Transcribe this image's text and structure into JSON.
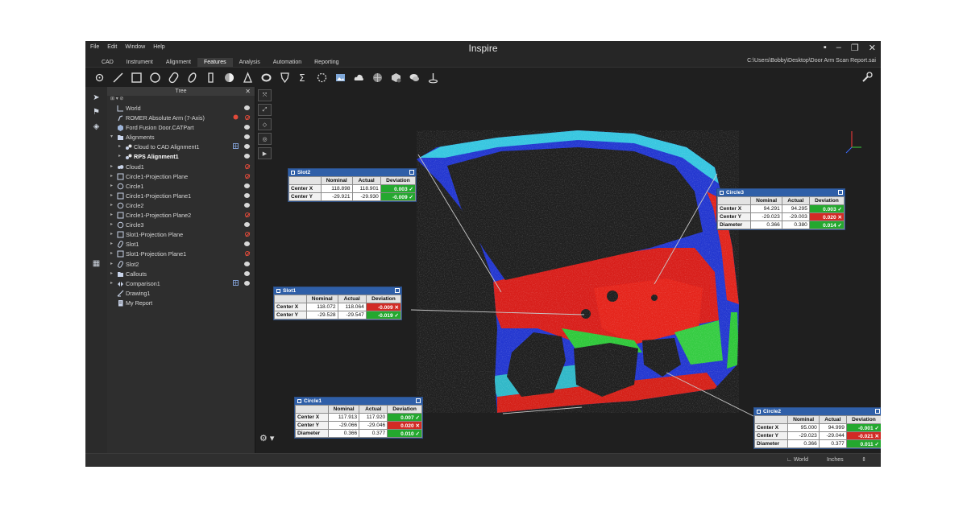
{
  "app": {
    "title": "Inspire",
    "menu": [
      "File",
      "Edit",
      "Window",
      "Help"
    ],
    "tabs": [
      "CAD",
      "Instrument",
      "Alignment",
      "Features",
      "Analysis",
      "Automation",
      "Reporting"
    ],
    "active_tab": "Features",
    "file_path": "C:\\Users\\Bobby\\Desktop\\Door Arm Scan Report.sai"
  },
  "toolbar": {
    "icons": [
      "point-icon",
      "line-icon",
      "plane-icon",
      "circle-icon",
      "slot-icon",
      "ellipse-icon",
      "rectangle-slot-icon",
      "sphere-icon",
      "cone-icon",
      "cylinder-icon",
      "surface-icon",
      "sum-icon",
      "auto-feature-icon",
      "image-icon",
      "cloud-icon",
      "mesh-icon",
      "inspect-icon",
      "comment-icon",
      "probe-icon"
    ]
  },
  "tree": {
    "title": "Tree",
    "items": [
      {
        "label": "World",
        "indent": 0,
        "expand": "",
        "icon": "axis",
        "state": "eye"
      },
      {
        "label": "ROMER Absolute Arm (7-Axis)",
        "indent": 0,
        "expand": "",
        "icon": "arm",
        "state": "hide",
        "mark": "red"
      },
      {
        "label": "Ford Fusion Door.CATPart",
        "indent": 0,
        "expand": "",
        "icon": "part",
        "state": "eye"
      },
      {
        "label": "Alignments",
        "indent": 0,
        "expand": "▾",
        "icon": "folder",
        "state": "eye"
      },
      {
        "label": "Cloud to CAD Alignment1",
        "indent": 1,
        "expand": "▸",
        "icon": "align",
        "state": "eye",
        "mark": "grid"
      },
      {
        "label": "RPS Alignment1",
        "indent": 1,
        "expand": "▸",
        "icon": "align",
        "state": "eye",
        "bold": true
      },
      {
        "label": "Cloud1",
        "indent": 0,
        "expand": "▸",
        "icon": "cloud",
        "state": "hide"
      },
      {
        "label": "Circle1-Projection Plane",
        "indent": 0,
        "expand": "▸",
        "icon": "plane",
        "state": "hide"
      },
      {
        "label": "Circle1",
        "indent": 0,
        "expand": "▸",
        "icon": "circle",
        "state": "eye"
      },
      {
        "label": "Circle1-Projection Plane1",
        "indent": 0,
        "expand": "▸",
        "icon": "plane",
        "state": "eye"
      },
      {
        "label": "Circle2",
        "indent": 0,
        "expand": "▸",
        "icon": "circle",
        "state": "eye"
      },
      {
        "label": "Circle1-Projection Plane2",
        "indent": 0,
        "expand": "▸",
        "icon": "plane",
        "state": "hide"
      },
      {
        "label": "Circle3",
        "indent": 0,
        "expand": "▸",
        "icon": "circle",
        "state": "eye"
      },
      {
        "label": "Slot1-Projection Plane",
        "indent": 0,
        "expand": "▸",
        "icon": "plane",
        "state": "hide"
      },
      {
        "label": "Slot1",
        "indent": 0,
        "expand": "▸",
        "icon": "slot",
        "state": "eye"
      },
      {
        "label": "Slot1-Projection Plane1",
        "indent": 0,
        "expand": "▸",
        "icon": "plane",
        "state": "hide"
      },
      {
        "label": "Slot2",
        "indent": 0,
        "expand": "▸",
        "icon": "slot",
        "state": "eye"
      },
      {
        "label": "Callouts",
        "indent": 0,
        "expand": "▸",
        "icon": "folder",
        "state": "eye"
      },
      {
        "label": "Comparison1",
        "indent": 0,
        "expand": "▸",
        "icon": "compare",
        "state": "eye",
        "mark": "grid"
      },
      {
        "label": "Drawing1",
        "indent": 0,
        "expand": "",
        "icon": "drawing",
        "state": ""
      },
      {
        "label": "My Report",
        "indent": 0,
        "expand": "",
        "icon": "report",
        "state": ""
      }
    ]
  },
  "callout_headers": [
    "",
    "Nominal",
    "Actual",
    "Deviation"
  ],
  "callouts": [
    {
      "title": "Slot2",
      "rows": [
        {
          "label": "Center X",
          "nominal": "118.898",
          "actual": "118.901",
          "deviation": "0.003",
          "status": "pass"
        },
        {
          "label": "Center Y",
          "nominal": "-29.921",
          "actual": "-29.930",
          "deviation": "-0.009",
          "status": "pass"
        }
      ]
    },
    {
      "title": "Circle3",
      "rows": [
        {
          "label": "Center X",
          "nominal": "94.291",
          "actual": "94.295",
          "deviation": "0.003",
          "status": "pass"
        },
        {
          "label": "Center Y",
          "nominal": "-29.023",
          "actual": "-29.003",
          "deviation": "0.020",
          "status": "fail"
        },
        {
          "label": "Diameter",
          "nominal": "0.366",
          "actual": "0.380",
          "deviation": "0.014",
          "status": "pass"
        }
      ]
    },
    {
      "title": "Slot1",
      "rows": [
        {
          "label": "Center X",
          "nominal": "118.072",
          "actual": "118.064",
          "deviation": "-0.009",
          "status": "fail"
        },
        {
          "label": "Center Y",
          "nominal": "-29.528",
          "actual": "-29.547",
          "deviation": "-0.019",
          "status": "pass"
        }
      ]
    },
    {
      "title": "Circle1",
      "rows": [
        {
          "label": "Center X",
          "nominal": "117.913",
          "actual": "117.920",
          "deviation": "0.007",
          "status": "pass"
        },
        {
          "label": "Center Y",
          "nominal": "-29.066",
          "actual": "-29.046",
          "deviation": "0.020",
          "status": "fail"
        },
        {
          "label": "Diameter",
          "nominal": "0.366",
          "actual": "0.377",
          "deviation": "0.010",
          "status": "pass"
        }
      ]
    },
    {
      "title": "Circle2",
      "rows": [
        {
          "label": "Center X",
          "nominal": "95.000",
          "actual": "94.999",
          "deviation": "-0.001",
          "status": "pass"
        },
        {
          "label": "Center Y",
          "nominal": "-29.023",
          "actual": "-29.044",
          "deviation": "-0.021",
          "status": "fail"
        },
        {
          "label": "Diameter",
          "nominal": "0.366",
          "actual": "0.377",
          "deviation": "0.011",
          "status": "pass"
        }
      ]
    }
  ],
  "status": {
    "coordinate_system": "World",
    "units": "Inches"
  },
  "colors": {
    "pass": "#24a82f",
    "fail": "#d22b25",
    "callout_header": "#2f5fa8",
    "heatmap_high": "#e01e1e",
    "heatmap_mid": "#2fd03a",
    "heatmap_low": "#1f3fd6"
  }
}
